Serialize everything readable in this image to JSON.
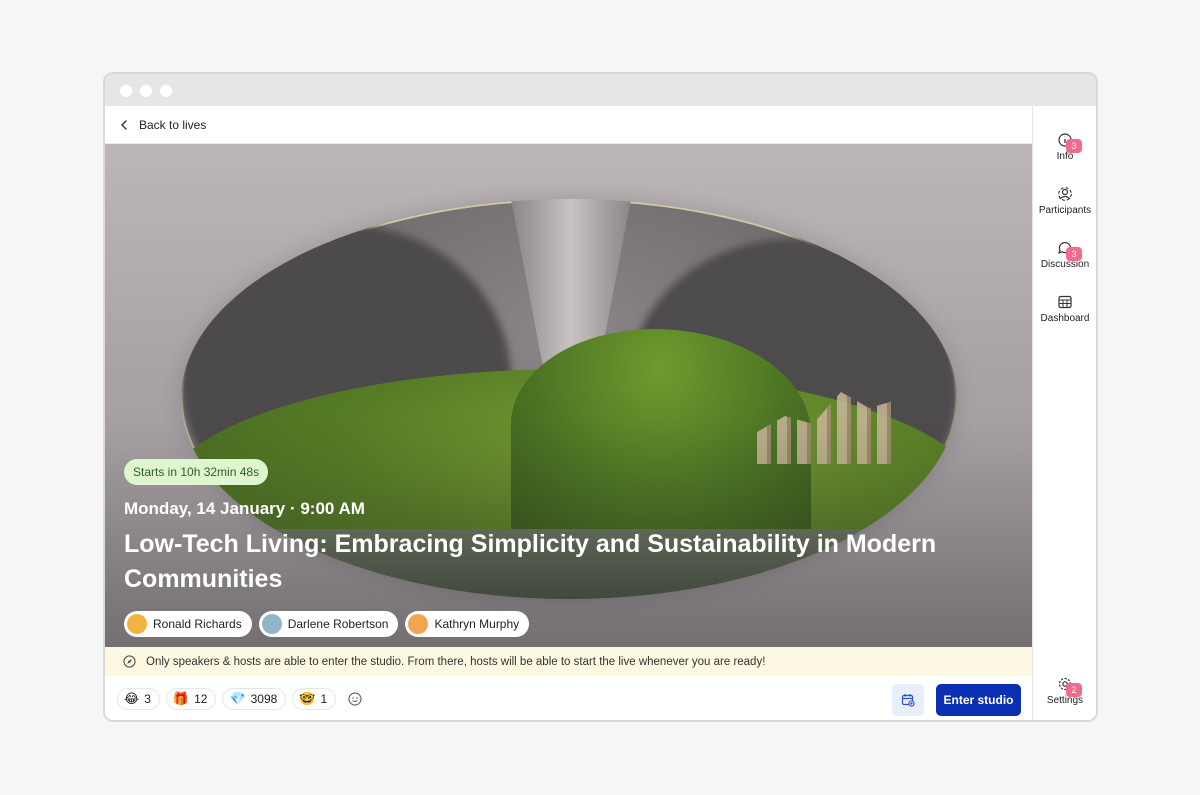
{
  "nav": {
    "back_label": "Back to lives"
  },
  "event": {
    "countdown": "Starts in 10h 32min 48s",
    "datetime": "Monday, 14 January · 9:00 AM",
    "title": "Low-Tech Living: Embracing Simplicity and Sustainability in Modern Communities",
    "speakers": [
      {
        "name": "Ronald Richards",
        "avatar_color": "#f2b441"
      },
      {
        "name": "Darlene Robertson",
        "avatar_color": "#8fb7c9"
      },
      {
        "name": "Kathryn Murphy",
        "avatar_color": "#f0a650"
      }
    ]
  },
  "notice": {
    "icon": "compass-icon",
    "text": "Only speakers & hosts are able to enter the studio. From there, hosts will be able to start the live whenever you are ready!"
  },
  "reactions": [
    {
      "emoji": "😂",
      "count": "3"
    },
    {
      "emoji": "🎁",
      "count": "12"
    },
    {
      "emoji": "💎",
      "count": "3098"
    },
    {
      "emoji": "🤓",
      "count": "1"
    }
  ],
  "actions": {
    "enter_label": "Enter studio"
  },
  "sidebar": {
    "items": [
      {
        "label": "Info",
        "badge": "3",
        "icon": "info-icon"
      },
      {
        "label": "Participants",
        "badge": "",
        "icon": "participants-icon"
      },
      {
        "label": "Discussion",
        "badge": "3",
        "icon": "chat-icon"
      },
      {
        "label": "Dashboard",
        "badge": "",
        "icon": "dashboard-icon"
      }
    ],
    "settings": {
      "label": "Settings",
      "badge": "2",
      "icon": "gear-icon"
    }
  },
  "colors": {
    "primary": "#0a2fb0",
    "badge": "#f26b8c",
    "countdown_bg": "#dff5cf",
    "notice_bg": "#fdf8e1"
  }
}
